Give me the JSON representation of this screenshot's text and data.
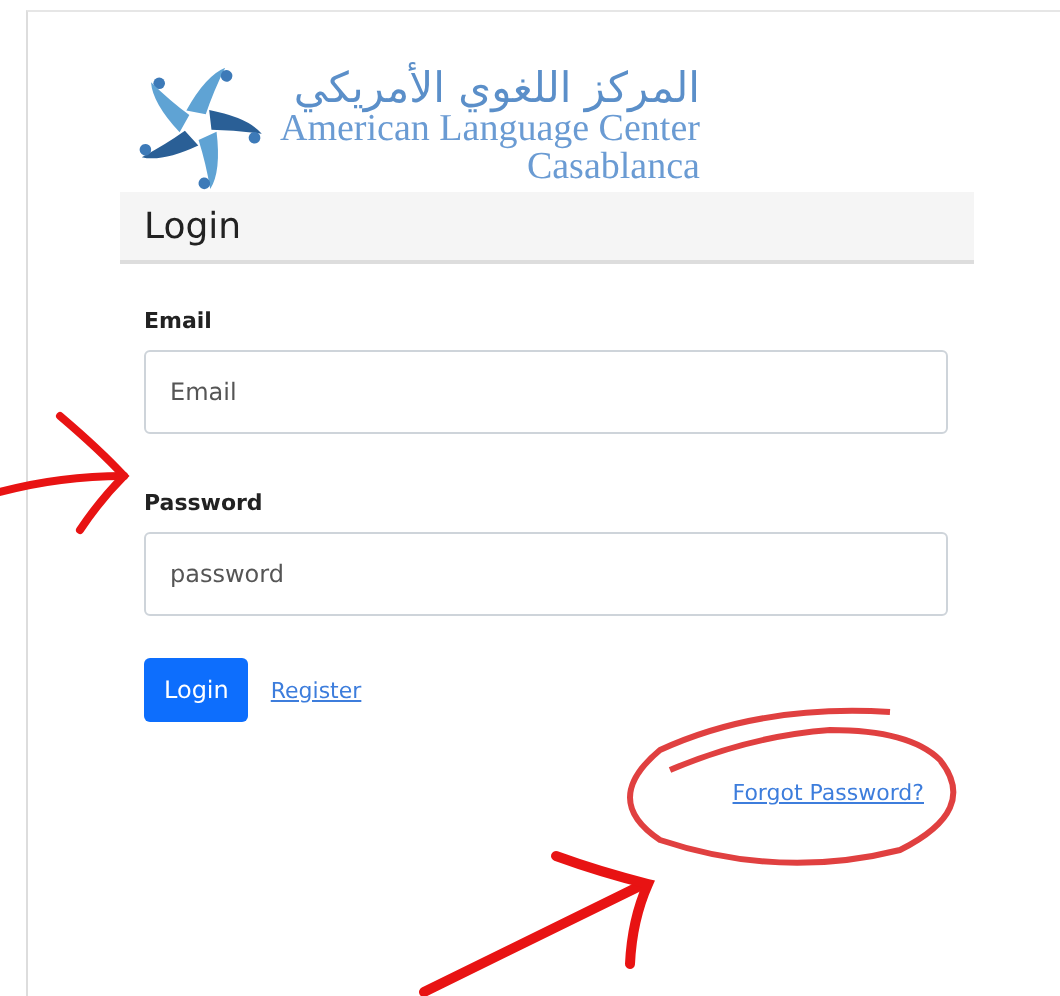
{
  "logo": {
    "arabic": "المركز اللغوي الأمريكي",
    "english": "American Language Center",
    "city": "Casablanca"
  },
  "card": {
    "title": "Login"
  },
  "fields": [
    {
      "label": "Email",
      "placeholder": "Email"
    },
    {
      "label": "Password",
      "placeholder": "password"
    }
  ],
  "buttons": {
    "login": "Login",
    "register": "Register",
    "forgot": "Forgot Password?"
  }
}
